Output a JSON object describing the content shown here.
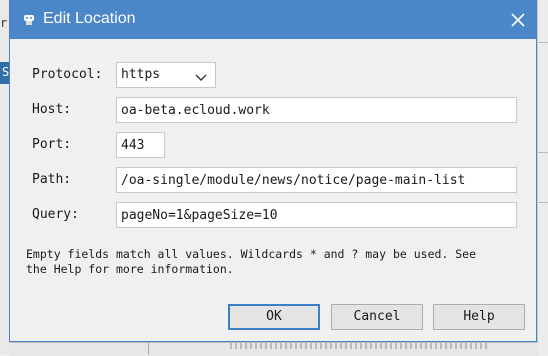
{
  "dialog": {
    "title": "Edit Location",
    "close_symbol": "close-icon"
  },
  "form": {
    "protocol": {
      "label": "Protocol:",
      "value": "https",
      "options": [
        "https"
      ]
    },
    "host": {
      "label": "Host:",
      "value": "oa-beta.ecloud.work"
    },
    "port": {
      "label": "Port:",
      "value": "443"
    },
    "path": {
      "label": "Path:",
      "value": "/oa-single/module/news/notice/page-main-list"
    },
    "query": {
      "label": "Query:",
      "value": "pageNo=1&pageSize=10"
    }
  },
  "hint": {
    "line1": "Empty fields match all values. Wildcards * and ? may be used. See",
    "line2": "the Help for more information."
  },
  "buttons": {
    "ok": "OK",
    "cancel": "Cancel",
    "help": "Help"
  },
  "background": {
    "left_char": "r",
    "left_selected_char": "S"
  },
  "colors": {
    "titlebar": "#4a86c8",
    "selection": "#2f6ea6",
    "default_button_border": "#3c7fc4"
  }
}
